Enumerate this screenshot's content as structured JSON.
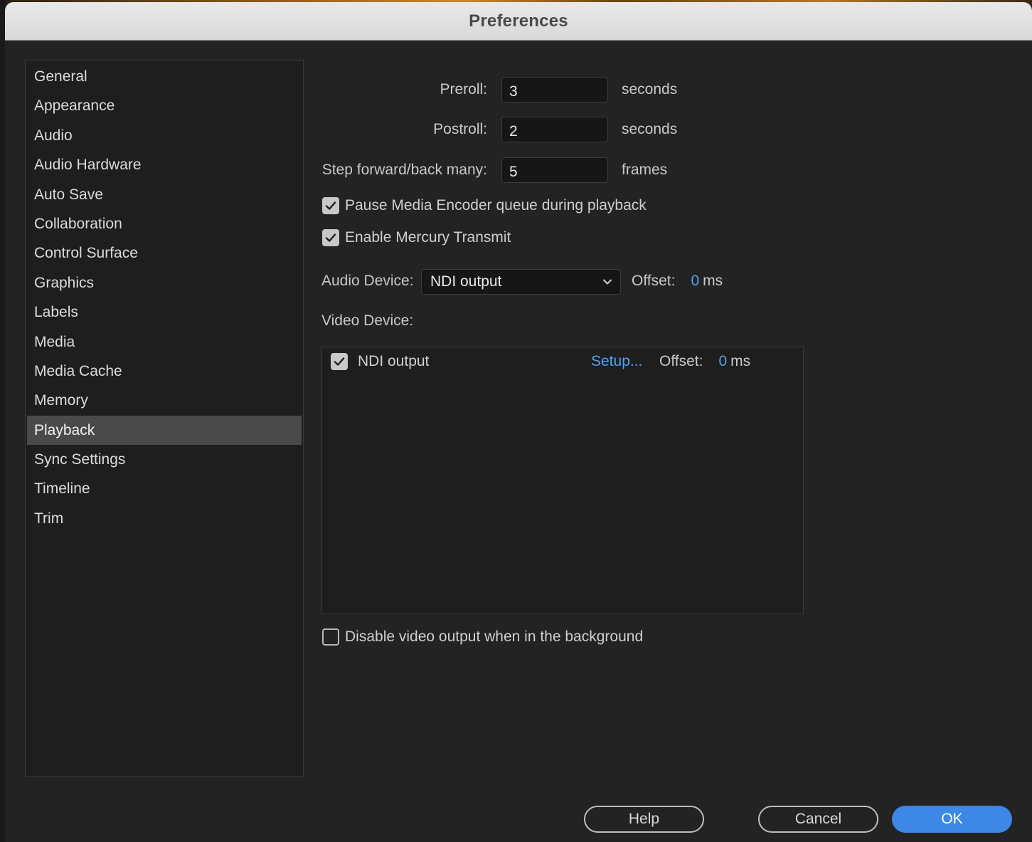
{
  "dialog": {
    "title": "Preferences"
  },
  "sidebar": {
    "items": [
      {
        "label": "General"
      },
      {
        "label": "Appearance"
      },
      {
        "label": "Audio"
      },
      {
        "label": "Audio Hardware"
      },
      {
        "label": "Auto Save"
      },
      {
        "label": "Collaboration"
      },
      {
        "label": "Control Surface"
      },
      {
        "label": "Graphics"
      },
      {
        "label": "Labels"
      },
      {
        "label": "Media"
      },
      {
        "label": "Media Cache"
      },
      {
        "label": "Memory"
      },
      {
        "label": "Playback"
      },
      {
        "label": "Sync Settings"
      },
      {
        "label": "Timeline"
      },
      {
        "label": "Trim"
      }
    ],
    "selected": "Playback"
  },
  "playback": {
    "preroll": {
      "label": "Preroll:",
      "value": "3",
      "unit": "seconds"
    },
    "postroll": {
      "label": "Postroll:",
      "value": "2",
      "unit": "seconds"
    },
    "step": {
      "label": "Step forward/back many:",
      "value": "5",
      "unit": "frames"
    },
    "pause_encoder": {
      "label": "Pause Media Encoder queue during playback",
      "checked": true
    },
    "mercury_transmit": {
      "label": "Enable Mercury Transmit",
      "checked": true
    },
    "audio_device": {
      "label": "Audio Device:",
      "value": "NDI output",
      "offset_label": "Offset:",
      "offset_value": "0",
      "offset_unit": "ms"
    },
    "video_device": {
      "label": "Video Device:",
      "devices": [
        {
          "name": "NDI output",
          "checked": true,
          "setup": "Setup...",
          "offset_label": "Offset:",
          "offset_value": "0",
          "offset_unit": "ms"
        }
      ]
    },
    "disable_background": {
      "label": "Disable video output when in the background",
      "checked": false
    }
  },
  "footer": {
    "help": "Help",
    "cancel": "Cancel",
    "ok": "OK"
  },
  "colors": {
    "accent": "#3d88e6",
    "link": "#4fa3f0",
    "selected": "#4a4a4a"
  },
  "icons": {
    "checkmark": "check-icon",
    "dropdown": "chevron-down-icon"
  }
}
